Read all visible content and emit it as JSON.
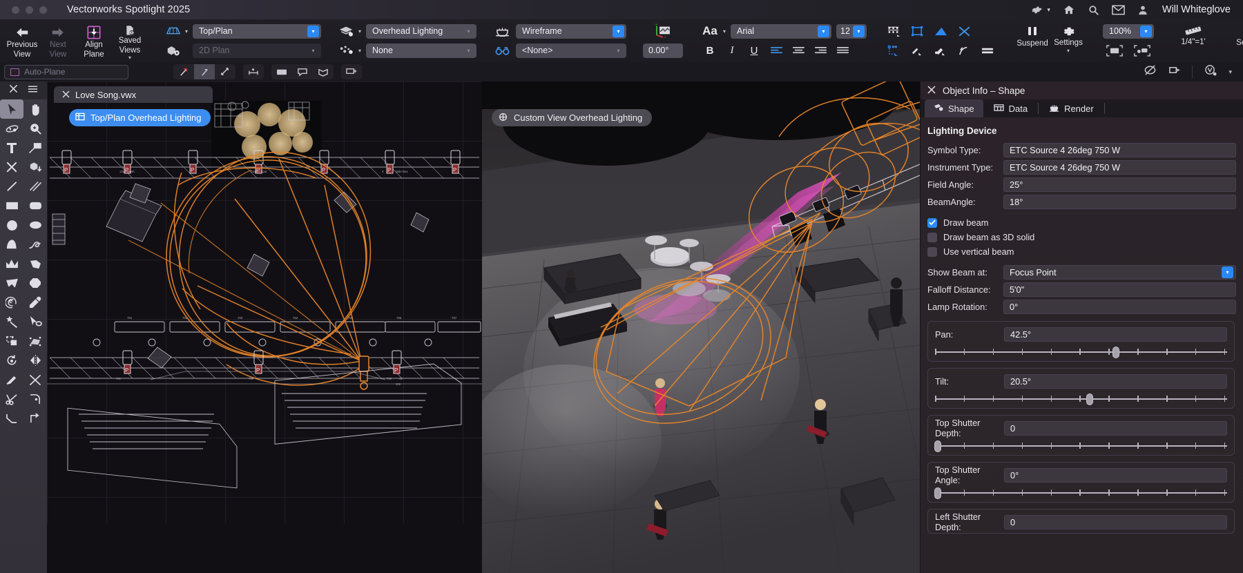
{
  "titlebar": {
    "app_title": "Vectorworks Spotlight 2025",
    "user_name": "Will Whiteglove",
    "icons": [
      "gear-icon",
      "home-icon",
      "search-icon",
      "mail-icon",
      "account-icon"
    ]
  },
  "toolbar": {
    "previous_view": "Previous\nView",
    "previous_view_l1": "Previous",
    "previous_view_l2": "View",
    "next_view_l1": "Next",
    "next_view_l2": "View",
    "align_plane_l1": "Align",
    "align_plane_l2": "Plane",
    "saved_views_l1": "Saved",
    "saved_views_l2": "Views",
    "view_select": "Top/Plan",
    "projection_select": "2D Plan",
    "layer_select": "Overhead Lighting",
    "class_select": "None",
    "render_select": "Wireframe",
    "lighting_select": "<None>",
    "rotation_value": "0.00°",
    "font_family": "Arial",
    "font_size": "12",
    "bold": "B",
    "italic": "I",
    "underline": "U",
    "suspend": "Suspend",
    "snap_settings": "Settings",
    "zoom_level": "100%",
    "scale": "1/4\"=1'",
    "view_settings": "Settings"
  },
  "bar2": {
    "auto_plane": "Auto-Plane"
  },
  "tool_palette": {
    "tools": [
      "selection-arrow-icon",
      "pan-hand-icon",
      "flyover-icon",
      "zoom-icon",
      "text-icon",
      "callout-icon",
      "delete-x-icon",
      "push-pull-icon",
      "line-icon",
      "double-line-icon",
      "rectangle-icon",
      "rounded-rectangle-icon",
      "circle-icon",
      "ellipse-icon",
      "arc-icon",
      "spline-icon",
      "polyline-icon",
      "polygon-icon",
      "freehand-polygon-icon",
      "hexagon-icon",
      "spiral-icon",
      "eyedropper-icon",
      "magic-wand-icon",
      "select-similar-icon",
      "move-by-points-icon",
      "mirror-duplicate-icon",
      "rotate-icon",
      "mirror-icon",
      "trim-icon",
      "split-x-icon",
      "scissors-icon",
      "fillet-icon",
      "chamfer-icon",
      "offset-icon"
    ]
  },
  "document": {
    "tab_name": "Love Song.vwx",
    "viewport_left_label": "Top/Plan Overhead Lighting",
    "viewport_right_label": "Custom View Overhead Lighting"
  },
  "object_info": {
    "panel_title": "Object Info – Shape",
    "tabs": [
      {
        "label": "Shape",
        "icon": "shape-icon",
        "active": true
      },
      {
        "label": "Data",
        "icon": "data-icon",
        "active": false
      },
      {
        "label": "Render",
        "icon": "render-icon",
        "active": false
      }
    ],
    "group_header": "Lighting Device",
    "fields": [
      {
        "label": "Symbol Type:",
        "value": "ETC Source 4 26deg 750 W",
        "dropdown": false
      },
      {
        "label": "Instrument Type:",
        "value": "ETC Source 4 26deg 750 W",
        "dropdown": false
      },
      {
        "label": "Field Angle:",
        "value": "25°",
        "dropdown": false
      },
      {
        "label": "BeamAngle:",
        "value": "18°",
        "dropdown": false
      }
    ],
    "checkboxes": [
      {
        "label": "Draw beam",
        "checked": true
      },
      {
        "label": "Draw beam as 3D solid",
        "checked": false
      },
      {
        "label": "Use vertical beam",
        "checked": false
      }
    ],
    "fields2": [
      {
        "label": "Show Beam at:",
        "value": "Focus Point",
        "dropdown": true
      },
      {
        "label": "Falloff Distance:",
        "value": "5'0\"",
        "dropdown": false
      },
      {
        "label": "Lamp Rotation:",
        "value": "0°",
        "dropdown": false
      }
    ],
    "sliders": [
      {
        "label": "Pan:",
        "value": "42.5°",
        "percent": 62
      },
      {
        "label": "Tilt:",
        "value": "20.5°",
        "percent": 53
      },
      {
        "label": "Top Shutter Depth:",
        "value": "0",
        "percent": 1
      },
      {
        "label": "Top Shutter Angle:",
        "value": "0°",
        "percent": 1
      },
      {
        "label": "Left Shutter Depth:",
        "value": "0",
        "percent": 1
      }
    ]
  },
  "colors": {
    "accent_blue": "#2b89f5",
    "beam_orange": "#e8862a",
    "beam_pink": "#e83fc8",
    "panel_bg": "#2a2329",
    "titlebar_bg": "#2e2b35"
  }
}
